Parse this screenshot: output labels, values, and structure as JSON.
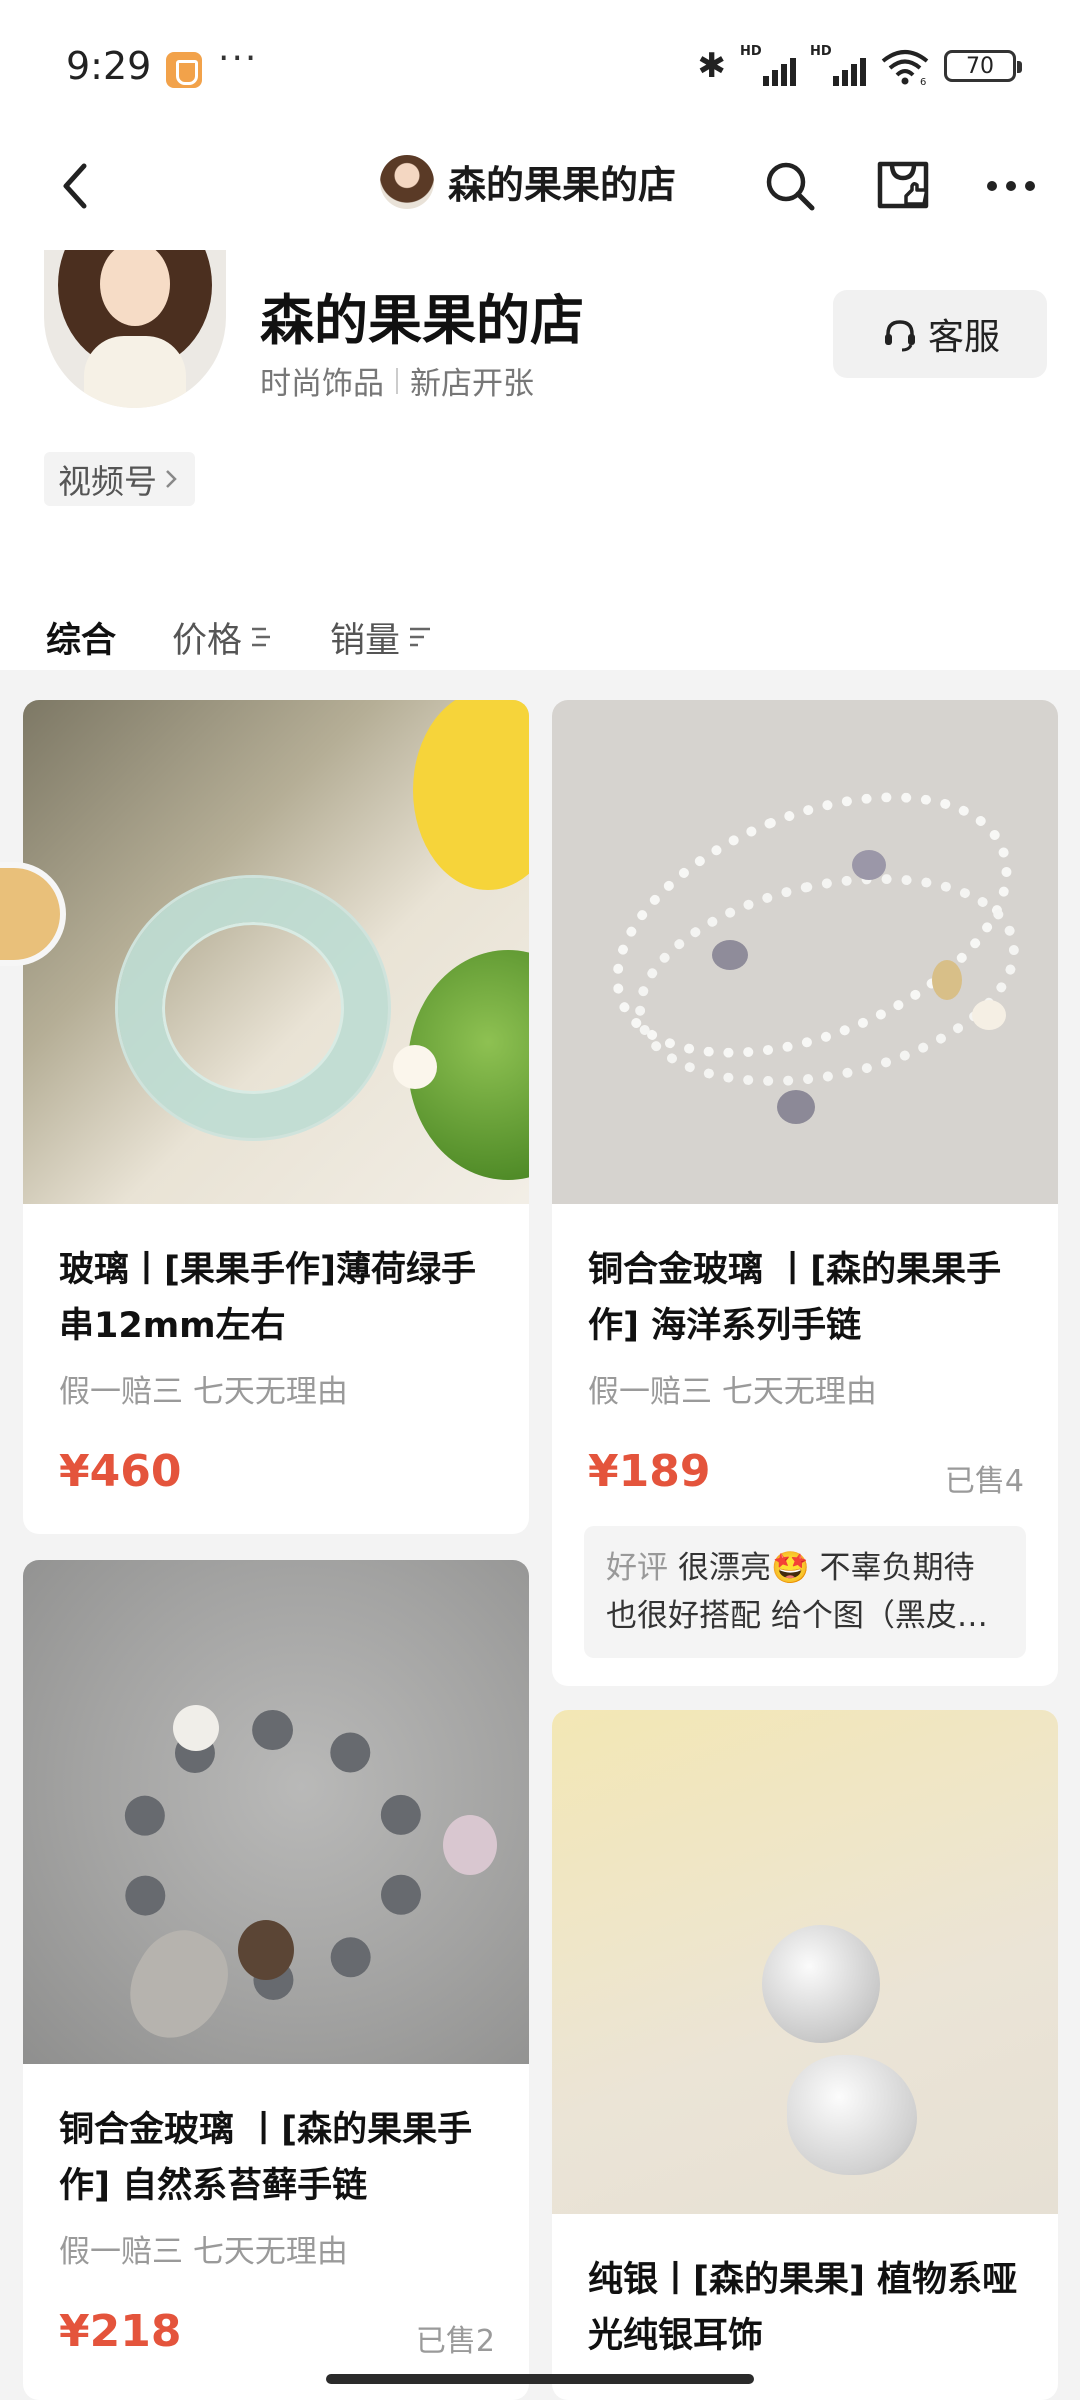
{
  "status_bar": {
    "time": "9:29",
    "more": "···",
    "signal_1": "HD",
    "signal_2": "HD",
    "wifi_sub": "6",
    "battery": "70"
  },
  "nav": {
    "title": "森的果果的店"
  },
  "shop": {
    "name": "森的果果的店",
    "tags": [
      "时尚饰品",
      "新店开张"
    ],
    "service_label": "客服",
    "video_label": "视频号"
  },
  "sort_tabs": [
    {
      "label": "综合",
      "active": true
    },
    {
      "label": "价格",
      "active": false
    },
    {
      "label": "销量",
      "active": false
    }
  ],
  "products": [
    {
      "title": "玻璃丨[果果手作]薄荷绿手串12mm左右",
      "services": "假一赔三   七天无理由",
      "price": "¥460",
      "sold": ""
    },
    {
      "title": "铜合金玻璃 丨[森的果果手作] 海洋系列手链",
      "services": "假一赔三   七天无理由",
      "price": "¥189",
      "sold": "已售4",
      "review_label": "好评",
      "review_text": "很漂亮🤩 不辜负期待也很好搭配 给个图（黑皮…"
    },
    {
      "title": "铜合金玻璃 丨[森的果果手作] 自然系苔藓手链",
      "services": "假一赔三   七天无理由",
      "price": "¥218",
      "sold": "已售2"
    },
    {
      "title": "纯银丨[森的果果] 植物系哑光纯银耳饰",
      "services": "",
      "price": "",
      "sold": ""
    }
  ],
  "colors": {
    "price": "#e4543c",
    "background": "#f3f3f3",
    "card": "#ffffff"
  },
  "icons": [
    "back-icon",
    "search-icon",
    "shop-icon",
    "more-icon",
    "headset-icon",
    "chevron-right-icon",
    "sort-icon"
  ]
}
